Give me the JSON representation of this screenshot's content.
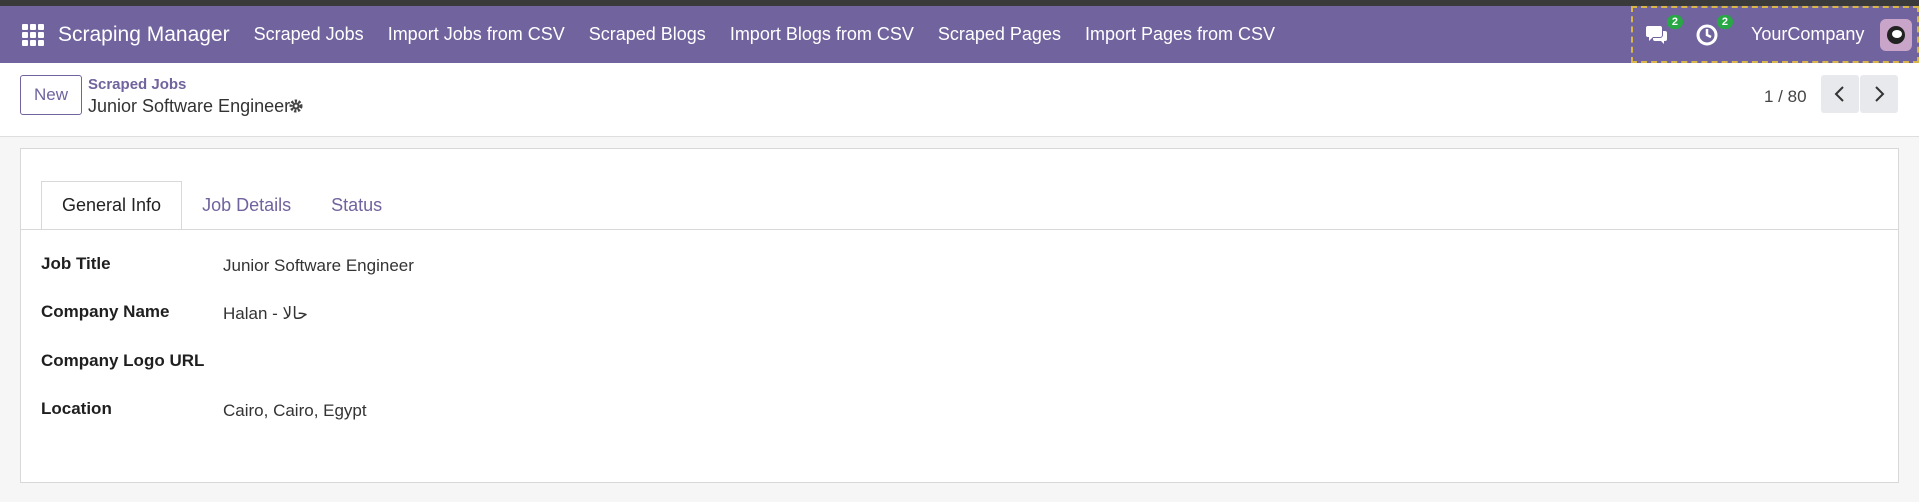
{
  "navbar": {
    "brand": "Scraping Manager",
    "menu": [
      "Scraped Jobs",
      "Import Jobs from CSV",
      "Scraped Blogs",
      "Import Blogs from CSV",
      "Scraped Pages",
      "Import Pages from CSV"
    ],
    "messages_badge": "2",
    "activities_badge": "2",
    "company": "YourCompany"
  },
  "control": {
    "new_label": "New",
    "breadcrumb": "Scraped Jobs",
    "record_name": "Junior Software Engineer",
    "pager": "1 / 80"
  },
  "tabs": [
    "General Info",
    "Job Details",
    "Status"
  ],
  "fields": [
    {
      "label": "Job Title",
      "value": "Junior Software Engineer"
    },
    {
      "label": "Company Name",
      "value": "Halan - حالا"
    },
    {
      "label": "Company Logo URL",
      "value": ""
    },
    {
      "label": "Location",
      "value": "Cairo, Cairo, Egypt"
    }
  ],
  "colors": {
    "accent": "#71639e",
    "badge": "#28a745"
  }
}
